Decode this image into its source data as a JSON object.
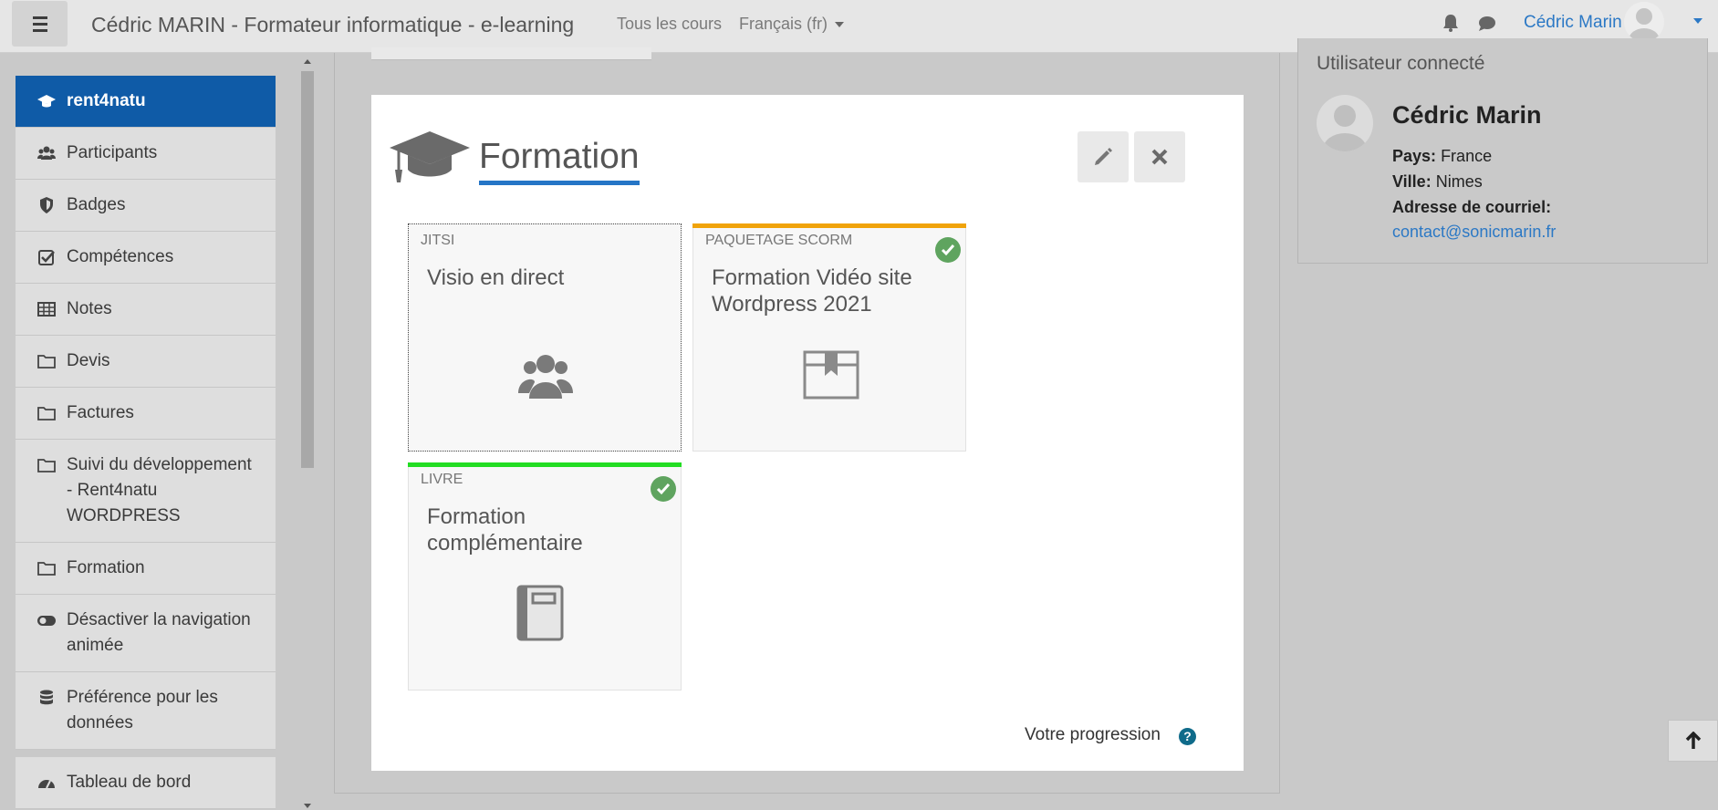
{
  "navbar": {
    "site_title": "Cédric MARIN - Formateur informatique - e-learning",
    "all_courses": "Tous les cours",
    "language": "Français (fr)",
    "user_name": "Cédric Marin",
    "icons": [
      "bell-icon",
      "chat-icon"
    ]
  },
  "drawer": {
    "items": [
      {
        "label": "rent4natu",
        "icon": "graduation-cap-icon",
        "active": true
      },
      {
        "label": "Participants",
        "icon": "users-icon"
      },
      {
        "label": "Badges",
        "icon": "shield-icon"
      },
      {
        "label": "Compétences",
        "icon": "checkbox-icon"
      },
      {
        "label": "Notes",
        "icon": "table-icon"
      },
      {
        "label": "Devis",
        "icon": "folder-icon"
      },
      {
        "label": "Factures",
        "icon": "folder-icon"
      },
      {
        "label": "Suivi du développement - Rent4natu WORDPRESS",
        "icon": "folder-icon"
      },
      {
        "label": "Formation",
        "icon": "folder-icon"
      },
      {
        "label": "Désactiver la navigation animée",
        "icon": "toggle-icon"
      },
      {
        "label": "Préférence pour les données",
        "icon": "database-icon"
      },
      {
        "label": "Tableau de bord",
        "icon": "dashboard-icon"
      }
    ]
  },
  "modal": {
    "title": "Formation",
    "tiles": [
      {
        "type": "JITSI",
        "name": "Visio en direct",
        "icon": "users-icon",
        "completed": false,
        "bar_color": ""
      },
      {
        "type": "PAQUETAGE SCORM",
        "name": "Formation Vidéo site Wordpress 2021",
        "icon": "package-icon",
        "completed": true,
        "bar_color": "#f0a30a"
      },
      {
        "type": "LIVRE",
        "name": "Formation complémentaire",
        "icon": "book-icon",
        "completed": true,
        "bar_color": "#22dd22"
      }
    ],
    "progress_label": "Votre progression",
    "help": "?"
  },
  "user_block": {
    "title": "Utilisateur connecté",
    "name": "Cédric Marin",
    "country_label": "Pays:",
    "country": "France",
    "city_label": "Ville:",
    "city": "Nimes",
    "email_label": "Adresse de courriel:",
    "email": "contact@sonicmarin.fr"
  },
  "colors": {
    "accent": "#0f5ba7",
    "link": "#2b78c5",
    "complete": "#5fa45f"
  }
}
